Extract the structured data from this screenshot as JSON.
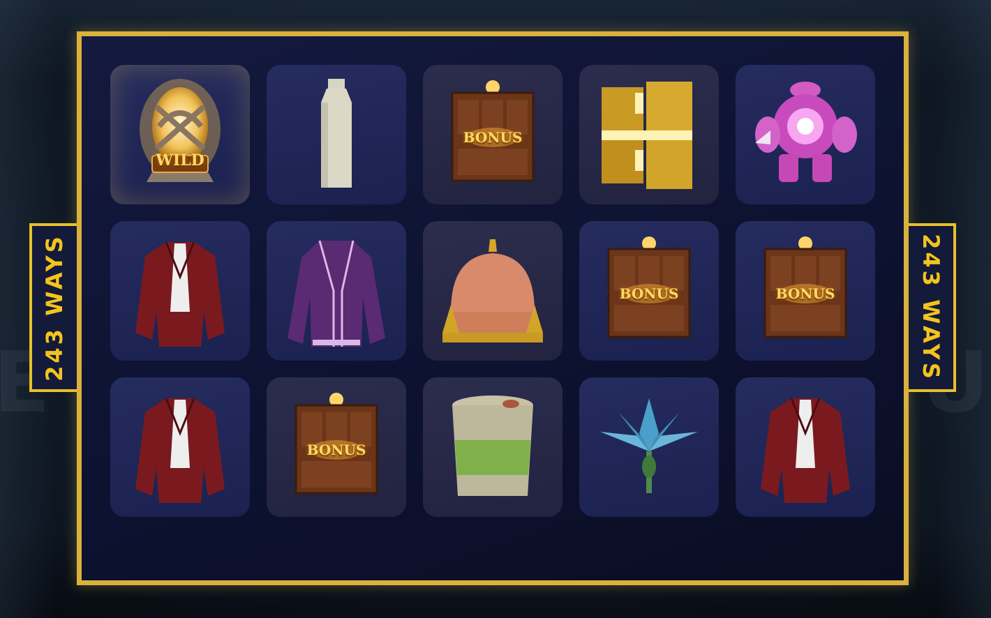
{
  "ways_label_left": "243 WAYS",
  "ways_label_right": "243 WAYS",
  "reels": [
    [
      {
        "symbol": "wild-egg",
        "caption": "WILD"
      },
      {
        "symbol": "red-plaid-blazer",
        "caption": ""
      },
      {
        "symbol": "red-plaid-blazer",
        "caption": ""
      }
    ],
    [
      {
        "symbol": "white-bottle",
        "caption": ""
      },
      {
        "symbol": "purple-jacket",
        "caption": ""
      },
      {
        "symbol": "bonus-chest",
        "caption": "BONUS"
      }
    ],
    [
      {
        "symbol": "bonus-chest",
        "caption": "BONUS"
      },
      {
        "symbol": "glitter-cake",
        "caption": ""
      },
      {
        "symbol": "green-cup",
        "caption": ""
      }
    ],
    [
      {
        "symbol": "gold-blocks",
        "caption": ""
      },
      {
        "symbol": "bonus-chest",
        "caption": "BONUS"
      },
      {
        "symbol": "blue-flower",
        "caption": ""
      }
    ],
    [
      {
        "symbol": "pink-robot",
        "caption": ""
      },
      {
        "symbol": "bonus-chest",
        "caption": "BONUS"
      },
      {
        "symbol": "red-plaid-blazer",
        "caption": ""
      }
    ]
  ],
  "colors": {
    "frame_gold": "#d9b13c",
    "label_yellow": "#f3c41d",
    "cell_blue": "#1b2150"
  }
}
